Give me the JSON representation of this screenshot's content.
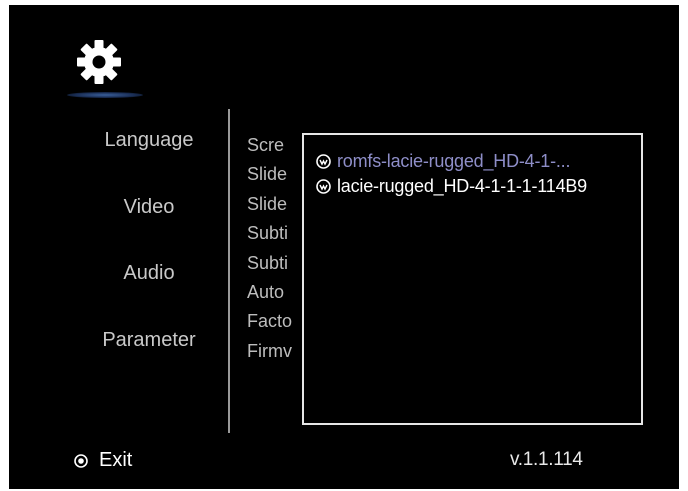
{
  "menu": {
    "items": [
      {
        "label": "Language"
      },
      {
        "label": "Video"
      },
      {
        "label": "Audio"
      },
      {
        "label": "Parameter"
      }
    ]
  },
  "settings": {
    "items": [
      {
        "label": "Scre"
      },
      {
        "label": "Slide"
      },
      {
        "label": "Slide"
      },
      {
        "label": "Subti"
      },
      {
        "label": "Subti"
      },
      {
        "label": "Auto"
      },
      {
        "label": "Facto"
      },
      {
        "label": "Firmv"
      }
    ]
  },
  "popup": {
    "items": [
      {
        "label": "romfs-lacie-rugged_HD-4-1-...",
        "icon": "device-icon",
        "state": "highlighted"
      },
      {
        "label": "lacie-rugged_HD-4-1-1-1-114B9",
        "icon": "device-icon",
        "state": "normal"
      }
    ]
  },
  "footer": {
    "exit_label": "Exit",
    "exit_icon": "exit-button-icon",
    "version": "v.1.1.114"
  },
  "header": {
    "icon": "gear-icon"
  },
  "colors": {
    "background": "#000000",
    "text": "#c9c9c9",
    "highlight": "#8e8ec8",
    "popup_border": "#e6e6e6",
    "accent_glow": "#3a5f9a"
  }
}
